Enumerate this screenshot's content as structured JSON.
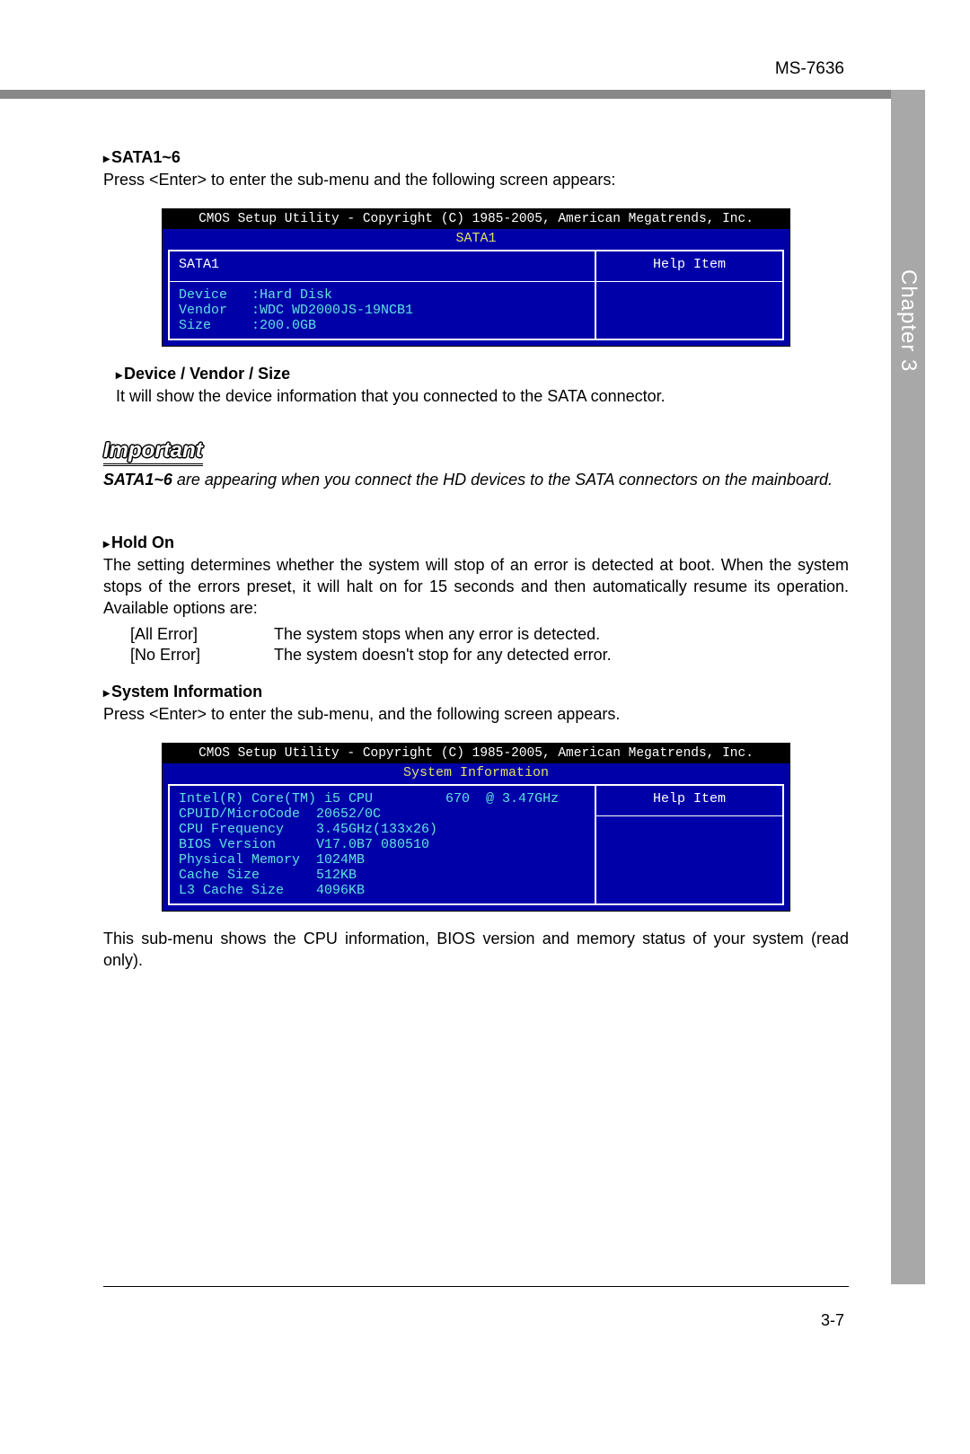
{
  "doc_id": "MS-7636",
  "side_tab": "Chapter 3",
  "page_num": "3-7",
  "s1": {
    "heading": "SATA1~6",
    "text": "Press <Enter> to enter the sub-menu and the following screen appears:"
  },
  "bios1": {
    "title": "CMOS Setup Utility - Copyright (C) 1985-2005, American Megatrends, Inc.",
    "subtitle": "SATA1",
    "left_header": "SATA1",
    "right_header": "Help Item",
    "rows": [
      "Device   :Hard Disk",
      "Vendor   :WDC WD2000JS-19NCB1",
      "Size     :200.0GB"
    ]
  },
  "s2": {
    "heading": "Device / Vendor / Size",
    "text": "It will show the device information that you connected to the SATA connector."
  },
  "important": {
    "label": "Important",
    "lead": "SATA1~6",
    "rest": " are appearing when you connect the HD devices to the SATA connectors on the mainboard."
  },
  "s3": {
    "heading": "Hold On",
    "text": "The setting determines whether the system will stop of an error is detected at boot. When the system stops of the errors preset, it will halt on for 15 seconds and then automatically resume its operation. Available options are:",
    "options": [
      {
        "key": "[All Error]",
        "val": "The system stops when any error is detected."
      },
      {
        "key": "[No Error]",
        "val": "The system doesn't stop for any detected error."
      }
    ]
  },
  "s4": {
    "heading": "System Information",
    "text": "Press <Enter> to enter the sub-menu, and the following screen appears."
  },
  "bios2": {
    "title": "CMOS Setup Utility - Copyright (C) 1985-2005, American Megatrends, Inc.",
    "subtitle": "System Information",
    "right_header": "Help Item",
    "rows": [
      "Intel(R) Core(TM) i5 CPU         670  @ 3.47GHz",
      "CPUID/MicroCode  20652/0C",
      "CPU Frequency    3.45GHz(133x26)",
      "BIOS Version     V17.0B7 080510",
      "Physical Memory  1024MB",
      "Cache Size       512KB",
      "L3 Cache Size    4096KB"
    ]
  },
  "s5": {
    "text": "This sub-menu shows the CPU information, BIOS version and memory status of your system (read only)."
  }
}
